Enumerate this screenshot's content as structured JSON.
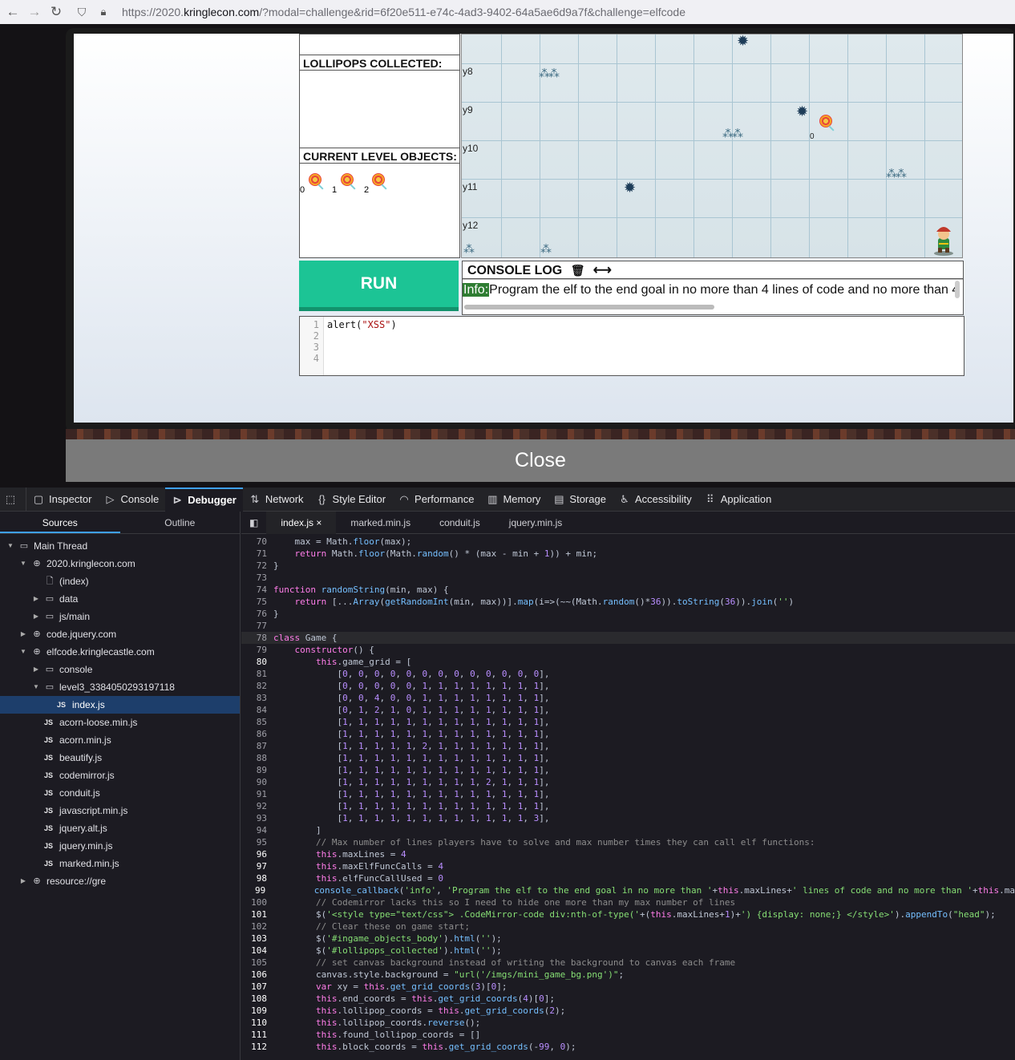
{
  "browser": {
    "url_prefix": "https://2020.",
    "url_domain": "kringlecon.com",
    "url_path": "/?modal=challenge&rid=6f20e511-e74c-4ad3-9402-64a5ae6d9a7f&challenge=elfcode"
  },
  "game": {
    "lollipops_collected_label": "LOLLIPOPS COLLECTED:",
    "current_objects_label": "CURRENT LEVEL OBJECTS:",
    "objects": [
      "0",
      "1",
      "2"
    ],
    "row_labels": [
      "y8",
      "y9",
      "y10",
      "y11",
      "y12"
    ],
    "lollipop_index_label": "0",
    "run_label": "RUN",
    "console_log_label": "CONSOLE LOG",
    "console_info_tag": "Info:",
    "console_message": "Program the elf to the end goal in no more than 4 lines of code and no more than 4",
    "editor_lines": [
      "1",
      "2",
      "3",
      "4"
    ],
    "editor_code_fn": "alert(",
    "editor_code_str": "\"XSS\"",
    "editor_code_end": ")",
    "close_label": "Close"
  },
  "devtools": {
    "tabs": [
      "Inspector",
      "Console",
      "Debugger",
      "Network",
      "Style Editor",
      "Performance",
      "Memory",
      "Storage",
      "Accessibility",
      "Application"
    ],
    "sidebar_tabs": [
      "Sources",
      "Outline"
    ],
    "tree": [
      {
        "label": "Main Thread",
        "depth": 0,
        "twisty": "open",
        "icon": "window"
      },
      {
        "label": "2020.kringlecon.com",
        "depth": 1,
        "twisty": "open",
        "icon": "globe"
      },
      {
        "label": "(index)",
        "depth": 2,
        "twisty": "",
        "icon": "file"
      },
      {
        "label": "data",
        "depth": 2,
        "twisty": "closed",
        "icon": "folder"
      },
      {
        "label": "js/main",
        "depth": 2,
        "twisty": "closed",
        "icon": "folder"
      },
      {
        "label": "code.jquery.com",
        "depth": 1,
        "twisty": "closed",
        "icon": "globe"
      },
      {
        "label": "elfcode.kringlecastle.com",
        "depth": 1,
        "twisty": "open",
        "icon": "globe"
      },
      {
        "label": "console",
        "depth": 2,
        "twisty": "closed",
        "icon": "folder"
      },
      {
        "label": "level3_3384050293197118",
        "depth": 2,
        "twisty": "open",
        "icon": "folder"
      },
      {
        "label": "index.js",
        "depth": 3,
        "twisty": "",
        "icon": "js",
        "selected": true
      },
      {
        "label": "acorn-loose.min.js",
        "depth": 2,
        "twisty": "",
        "icon": "js"
      },
      {
        "label": "acorn.min.js",
        "depth": 2,
        "twisty": "",
        "icon": "js"
      },
      {
        "label": "beautify.js",
        "depth": 2,
        "twisty": "",
        "icon": "js"
      },
      {
        "label": "codemirror.js",
        "depth": 2,
        "twisty": "",
        "icon": "js"
      },
      {
        "label": "conduit.js",
        "depth": 2,
        "twisty": "",
        "icon": "js"
      },
      {
        "label": "javascript.min.js",
        "depth": 2,
        "twisty": "",
        "icon": "js"
      },
      {
        "label": "jquery.alt.js",
        "depth": 2,
        "twisty": "",
        "icon": "js"
      },
      {
        "label": "jquery.min.js",
        "depth": 2,
        "twisty": "",
        "icon": "js"
      },
      {
        "label": "marked.min.js",
        "depth": 2,
        "twisty": "",
        "icon": "js"
      },
      {
        "label": "resource://gre",
        "depth": 1,
        "twisty": "closed",
        "icon": "globe"
      }
    ],
    "file_tabs": [
      "index.js",
      "marked.min.js",
      "conduit.js",
      "jquery.min.js"
    ],
    "close_file_glyph": "×",
    "code_lines": [
      {
        "n": "70",
        "t": "    max = Math.floor(max);"
      },
      {
        "n": "71",
        "t": "    return Math.floor(Math.random() * (max - min + 1)) + min;"
      },
      {
        "n": "72",
        "t": "}"
      },
      {
        "n": "73",
        "t": ""
      },
      {
        "n": "74",
        "t": "function randomString(min, max) {"
      },
      {
        "n": "75",
        "t": "    return [...Array(getRandomInt(min, max))].map(i=>(~~(Math.random()*36)).toString(36)).join('')"
      },
      {
        "n": "76",
        "t": "}"
      },
      {
        "n": "77",
        "t": ""
      },
      {
        "n": "78",
        "t": "class Game {",
        "hl": true
      },
      {
        "n": "79",
        "t": "    constructor() {"
      },
      {
        "n": "80",
        "t": "        this.game_grid = [",
        "b": true
      },
      {
        "n": "81",
        "t": "            [0, 0, 0, 0, 0, 0, 0, 0, 0, 0, 0, 0, 0],"
      },
      {
        "n": "82",
        "t": "            [0, 0, 0, 0, 0, 1, 1, 1, 1, 1, 1, 1, 1],"
      },
      {
        "n": "83",
        "t": "            [0, 0, 4, 0, 0, 1, 1, 1, 1, 1, 1, 1, 1],"
      },
      {
        "n": "84",
        "t": "            [0, 1, 2, 1, 0, 1, 1, 1, 1, 1, 1, 1, 1],"
      },
      {
        "n": "85",
        "t": "            [1, 1, 1, 1, 1, 1, 1, 1, 1, 1, 1, 1, 1],"
      },
      {
        "n": "86",
        "t": "            [1, 1, 1, 1, 1, 1, 1, 1, 1, 1, 1, 1, 1],"
      },
      {
        "n": "87",
        "t": "            [1, 1, 1, 1, 1, 2, 1, 1, 1, 1, 1, 1, 1],"
      },
      {
        "n": "88",
        "t": "            [1, 1, 1, 1, 1, 1, 1, 1, 1, 1, 1, 1, 1],"
      },
      {
        "n": "89",
        "t": "            [1, 1, 1, 1, 1, 1, 1, 1, 1, 1, 1, 1, 1],"
      },
      {
        "n": "90",
        "t": "            [1, 1, 1, 1, 1, 1, 1, 1, 1, 2, 1, 1, 1],"
      },
      {
        "n": "91",
        "t": "            [1, 1, 1, 1, 1, 1, 1, 1, 1, 1, 1, 1, 1],"
      },
      {
        "n": "92",
        "t": "            [1, 1, 1, 1, 1, 1, 1, 1, 1, 1, 1, 1, 1],"
      },
      {
        "n": "93",
        "t": "            [1, 1, 1, 1, 1, 1, 1, 1, 1, 1, 1, 1, 3],"
      },
      {
        "n": "94",
        "t": "        ]"
      },
      {
        "n": "95",
        "t": "        // Max number of lines players have to solve and max number times they can call elf functions:"
      },
      {
        "n": "96",
        "t": "        this.maxLines = 4",
        "b": true
      },
      {
        "n": "97",
        "t": "        this.maxElfFuncCalls = 4",
        "b": true
      },
      {
        "n": "98",
        "t": "        this.elfFuncCallUsed = 0",
        "b": true
      },
      {
        "n": "99",
        "t": "        console_callback('info', 'Program the elf to the end goal in no more than '+this.maxLines+' lines of code and no more than '+this.ma",
        "b": true
      },
      {
        "n": "100",
        "t": "        // Codemirror lacks this so I need to hide one more than my max number of lines"
      },
      {
        "n": "101",
        "t": "        $('<style type=\"text/css\"> .CodeMirror-code div:nth-of-type('+(this.maxLines+1)+') {display: none;} </style>').appendTo(\"head\");",
        "b": true
      },
      {
        "n": "102",
        "t": "        // Clear these on game start;"
      },
      {
        "n": "103",
        "t": "        $('#ingame_objects_body').html('');",
        "b": true
      },
      {
        "n": "104",
        "t": "        $('#lollipops_collected').html('');",
        "b": true
      },
      {
        "n": "105",
        "t": "        // set canvas background instead of writing the background to canvas each frame"
      },
      {
        "n": "106",
        "t": "        canvas.style.background = \"url('/imgs/mini_game_bg.png')\";",
        "b": true
      },
      {
        "n": "107",
        "t": "        var xy = this.get_grid_coords(3)[0];",
        "b": true
      },
      {
        "n": "108",
        "t": "        this.end_coords = this.get_grid_coords(4)[0];",
        "b": true
      },
      {
        "n": "109",
        "t": "        this.lollipop_coords = this.get_grid_coords(2);",
        "b": true
      },
      {
        "n": "110",
        "t": "        this.lollipop_coords.reverse();",
        "b": true
      },
      {
        "n": "111",
        "t": "        this.found_lollipop_coords = []",
        "b": true
      },
      {
        "n": "112",
        "t": "        this.block_coords = this.get_grid_coords(-99, 0);",
        "b": true
      }
    ]
  }
}
